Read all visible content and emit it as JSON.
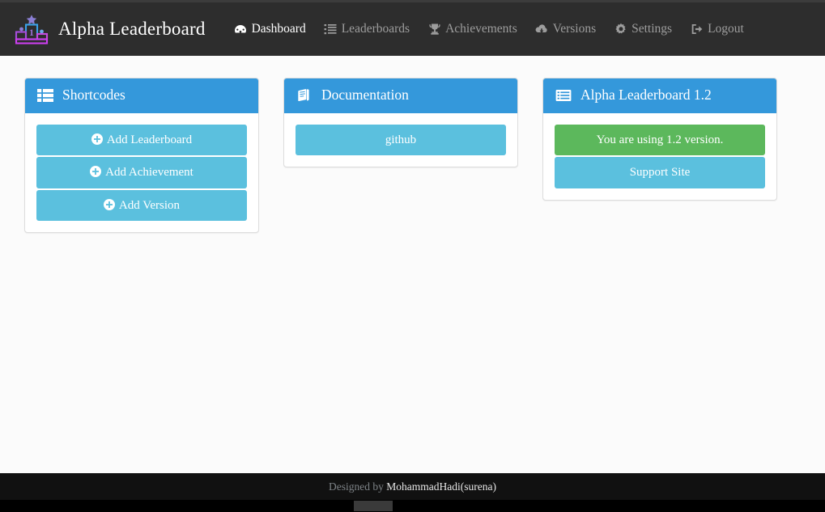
{
  "navbar": {
    "brand": {
      "text": "Alpha Leaderboard",
      "logo_icon": "podium-trophy-icon"
    },
    "items": [
      {
        "label": "Dashboard",
        "icon": "dashboard-icon",
        "active": true
      },
      {
        "label": "Leaderboards",
        "icon": "list-ol-icon",
        "active": false
      },
      {
        "label": "Achievements",
        "icon": "trophy-icon",
        "active": false
      },
      {
        "label": "Versions",
        "icon": "cloud-download-icon",
        "active": false
      },
      {
        "label": "Settings",
        "icon": "gear-icon",
        "active": false
      },
      {
        "label": "Logout",
        "icon": "sign-out-icon",
        "active": false
      }
    ]
  },
  "panels": [
    {
      "title": "Shortcodes",
      "icon": "th-list-icon",
      "buttons": [
        {
          "label": "Add Leaderboard",
          "style": "info",
          "icon": "plus-circle-icon"
        },
        {
          "label": "Add Achievement",
          "style": "info",
          "icon": "plus-circle-icon"
        },
        {
          "label": "Add Version",
          "style": "info",
          "icon": "plus-circle-icon"
        }
      ]
    },
    {
      "title": "Documentation",
      "icon": "book-icon",
      "buttons": [
        {
          "label": "github",
          "style": "info",
          "icon": ""
        }
      ]
    },
    {
      "title": "Alpha Leaderboard 1.2",
      "icon": "list-alt-icon",
      "buttons": [
        {
          "label": "You are using 1.2 version.",
          "style": "success",
          "icon": ""
        },
        {
          "label": "Support Site",
          "style": "info",
          "icon": ""
        }
      ]
    }
  ],
  "footer": {
    "prefix": "Designed by ",
    "author": "MohammadHadi(surena)"
  },
  "colors": {
    "navbar_bg": "#2d2d2d",
    "panel_header": "#3498db",
    "btn_info": "#5bc0de",
    "btn_success": "#5cb85c",
    "footer_bg": "#111111",
    "page_bg": "#fbfbfb"
  }
}
